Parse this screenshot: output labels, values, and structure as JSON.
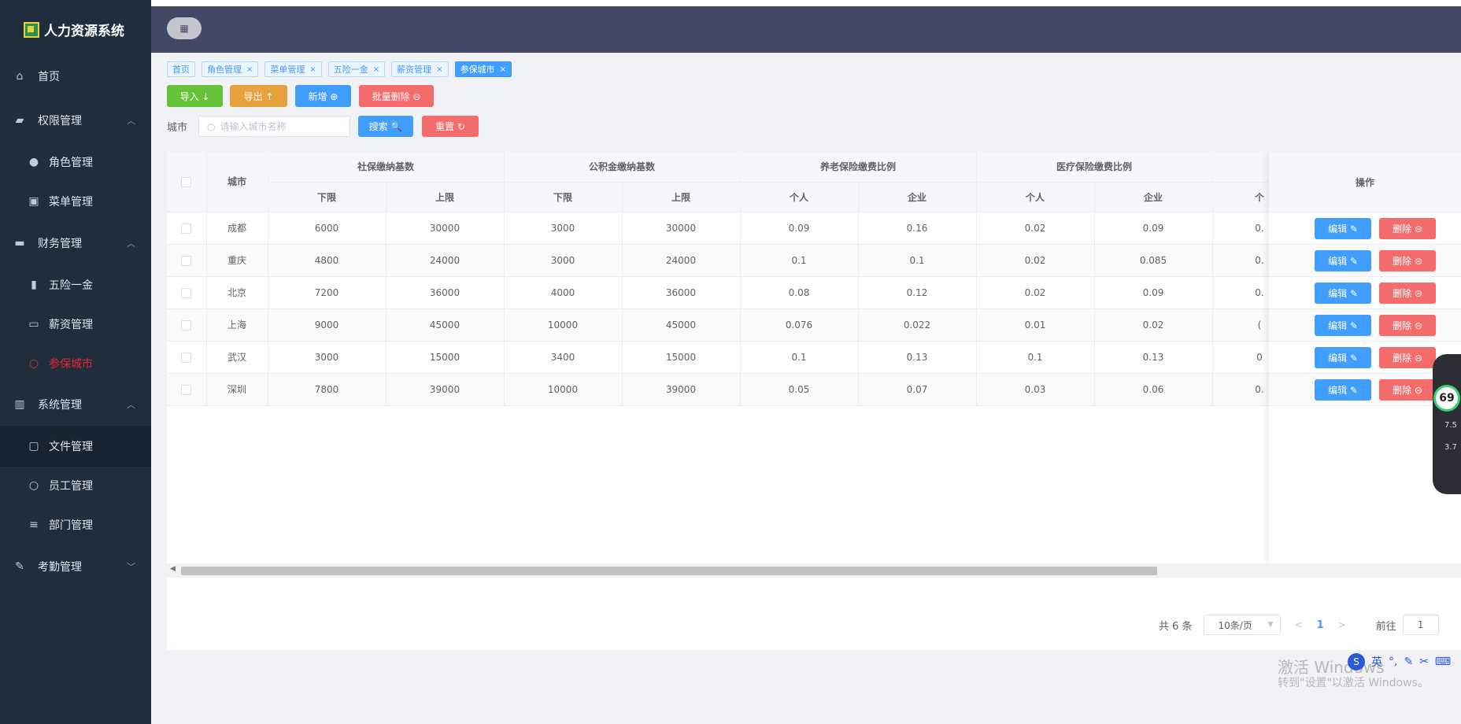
{
  "app": {
    "title": "人力资源系统"
  },
  "sidebar": {
    "items": [
      {
        "label": "首页",
        "icon": "home-icon"
      },
      {
        "label": "权限管理",
        "icon": "briefcase-icon"
      },
      {
        "label": "角色管理",
        "icon": "user-icon"
      },
      {
        "label": "菜单管理",
        "icon": "menu-doc-icon"
      },
      {
        "label": "财务管理",
        "icon": "wallet-icon"
      },
      {
        "label": "五险一金",
        "icon": "bar-chart-icon"
      },
      {
        "label": "薪资管理",
        "icon": "chart-board-icon"
      },
      {
        "label": "参保城市",
        "icon": "user-outline-icon"
      },
      {
        "label": "系统管理",
        "icon": "building-icon"
      },
      {
        "label": "文件管理",
        "icon": "folder-icon"
      },
      {
        "label": "员工管理",
        "icon": "person-icon"
      },
      {
        "label": "部门管理",
        "icon": "sliders-icon"
      },
      {
        "label": "考勤管理",
        "icon": "pencil-icon"
      }
    ]
  },
  "tags": [
    {
      "label": "首页"
    },
    {
      "label": "角色管理",
      "close": "×"
    },
    {
      "label": "菜单管理",
      "close": "×"
    },
    {
      "label": "五险一金",
      "close": "×"
    },
    {
      "label": "薪资管理",
      "close": "×"
    },
    {
      "label": "参保城市",
      "close": "×"
    }
  ],
  "toolbar": {
    "import_label": "导入 ↓",
    "export_label": "导出 ↑",
    "add_label": "新增 ⊕",
    "batch_delete_label": "批量删除 ⊝",
    "search_label": "搜索 🔍",
    "reset_label": "重置 ↻"
  },
  "filter": {
    "city_label": "城市",
    "city_placeholder": "请输入城市名称"
  },
  "table": {
    "col_city": "城市",
    "group_social": "社保缴纳基数",
    "group_fund": "公积金缴纳基数",
    "group_pension": "养老保险缴费比例",
    "group_medical": "医疗保险缴费比例",
    "lower": "下限",
    "upper": "上限",
    "personal": "个人",
    "company": "企业",
    "personal_cut": "个",
    "ops": "操作",
    "rows": [
      {
        "city": "成都",
        "s_low": "6000",
        "s_high": "30000",
        "f_low": "3000",
        "f_high": "30000",
        "p_p": "0.09",
        "p_c": "0.16",
        "m_p": "0.02",
        "m_c": "0.09",
        "x": "0."
      },
      {
        "city": "重庆",
        "s_low": "4800",
        "s_high": "24000",
        "f_low": "3000",
        "f_high": "24000",
        "p_p": "0.1",
        "p_c": "0.1",
        "m_p": "0.02",
        "m_c": "0.085",
        "x": "0."
      },
      {
        "city": "北京",
        "s_low": "7200",
        "s_high": "36000",
        "f_low": "4000",
        "f_high": "36000",
        "p_p": "0.08",
        "p_c": "0.12",
        "m_p": "0.02",
        "m_c": "0.09",
        "x": "0."
      },
      {
        "city": "上海",
        "s_low": "9000",
        "s_high": "45000",
        "f_low": "10000",
        "f_high": "45000",
        "p_p": "0.076",
        "p_c": "0.022",
        "m_p": "0.01",
        "m_c": "0.02",
        "x": "("
      },
      {
        "city": "武汉",
        "s_low": "3000",
        "s_high": "15000",
        "f_low": "3400",
        "f_high": "15000",
        "p_p": "0.1",
        "p_c": "0.13",
        "m_p": "0.1",
        "m_c": "0.13",
        "x": "0"
      },
      {
        "city": "深圳",
        "s_low": "7800",
        "s_high": "39000",
        "f_low": "10000",
        "f_high": "39000",
        "p_p": "0.05",
        "p_c": "0.07",
        "m_p": "0.03",
        "m_c": "0.06",
        "x": "0."
      }
    ],
    "edit_label": "编辑 ✎",
    "delete_label": "删除 ⊝"
  },
  "pagination": {
    "total": "共 6 条",
    "page_size": "10条/页",
    "current": "1",
    "goto_label": "前往",
    "goto_value": "1"
  },
  "overlay": {
    "watermark_line1": "激活 Windows",
    "watermark_line2": "转到\"设置\"以激活 Windows。",
    "gauge": "69",
    "up_speed": "7.5",
    "down_speed": "3.7",
    "ime_label": "英"
  }
}
